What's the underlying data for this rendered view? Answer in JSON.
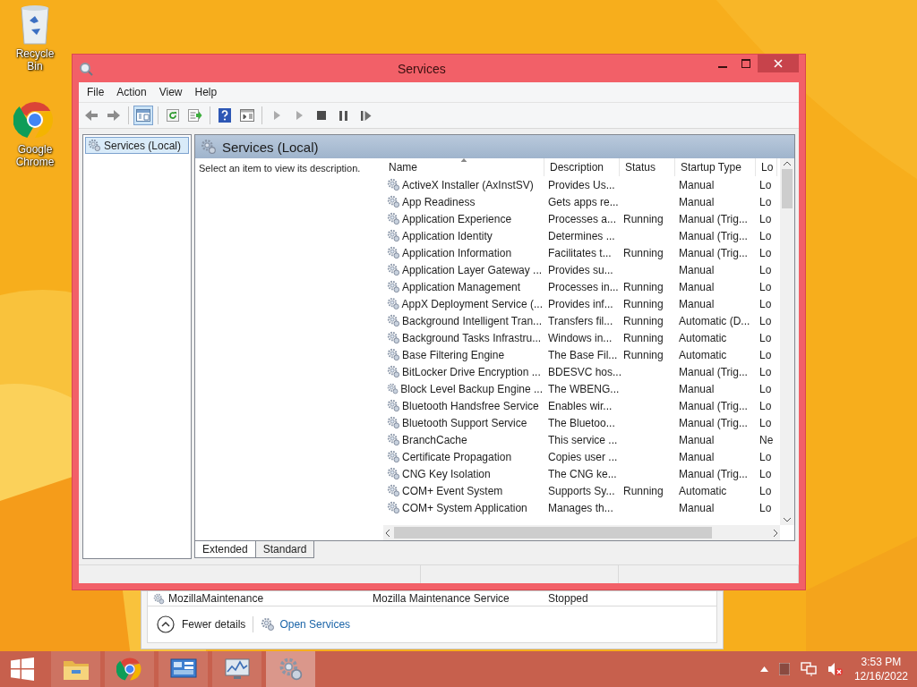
{
  "desktop_icons": [
    {
      "kind": "recycle",
      "label": "Recycle Bin"
    },
    {
      "kind": "chrome",
      "label": "Google Chrome"
    }
  ],
  "window": {
    "title": "Services"
  },
  "menu": [
    "File",
    "Action",
    "View",
    "Help"
  ],
  "toolbar": [
    {
      "kind": "back",
      "pressed": false,
      "disabled": false
    },
    {
      "kind": "forward",
      "pressed": false,
      "disabled": false
    },
    {
      "kind": "tree",
      "pressed": true,
      "disabled": false
    },
    {
      "kind": "refresh",
      "pressed": false,
      "disabled": false
    },
    {
      "kind": "export",
      "pressed": false,
      "disabled": false
    },
    {
      "kind": "help",
      "pressed": false,
      "disabled": false
    },
    {
      "kind": "panel",
      "pressed": false,
      "disabled": false
    },
    {
      "kind": "play",
      "pressed": false,
      "disabled": true
    },
    {
      "kind": "play",
      "pressed": false,
      "disabled": true
    },
    {
      "kind": "stop",
      "pressed": false,
      "disabled": false
    },
    {
      "kind": "pause",
      "pressed": false,
      "disabled": false
    },
    {
      "kind": "resume",
      "pressed": false,
      "disabled": false
    }
  ],
  "tree": [
    {
      "label": "Services (Local)",
      "selected": true
    }
  ],
  "pane": {
    "title": "Services (Local)",
    "description": "Select an item to view its description."
  },
  "table": {
    "columns": [
      {
        "label": "Name",
        "sorted": true
      },
      {
        "label": "Description",
        "sorted": false
      },
      {
        "label": "Status",
        "sorted": false
      },
      {
        "label": "Startup Type",
        "sorted": false
      },
      {
        "label": "Lo",
        "sorted": false
      }
    ],
    "rows": [
      [
        "ActiveX Installer (AxInstSV)",
        "Provides Us...",
        "",
        "Manual",
        "Lo"
      ],
      [
        "App Readiness",
        "Gets apps re...",
        "",
        "Manual",
        "Lo"
      ],
      [
        "Application Experience",
        "Processes a...",
        "Running",
        "Manual (Trig...",
        "Lo"
      ],
      [
        "Application Identity",
        "Determines ...",
        "",
        "Manual (Trig...",
        "Lo"
      ],
      [
        "Application Information",
        "Facilitates t...",
        "Running",
        "Manual (Trig...",
        "Lo"
      ],
      [
        "Application Layer Gateway ...",
        "Provides su...",
        "",
        "Manual",
        "Lo"
      ],
      [
        "Application Management",
        "Processes in...",
        "Running",
        "Manual",
        "Lo"
      ],
      [
        "AppX Deployment Service (...",
        "Provides inf...",
        "Running",
        "Manual",
        "Lo"
      ],
      [
        "Background Intelligent Tran...",
        "Transfers fil...",
        "Running",
        "Automatic (D...",
        "Lo"
      ],
      [
        "Background Tasks Infrastru...",
        "Windows in...",
        "Running",
        "Automatic",
        "Lo"
      ],
      [
        "Base Filtering Engine",
        "The Base Fil...",
        "Running",
        "Automatic",
        "Lo"
      ],
      [
        "BitLocker Drive Encryption ...",
        "BDESVC hos...",
        "",
        "Manual (Trig...",
        "Lo"
      ],
      [
        "Block Level Backup Engine ...",
        "The WBENG...",
        "",
        "Manual",
        "Lo"
      ],
      [
        "Bluetooth Handsfree Service",
        "Enables wir...",
        "",
        "Manual (Trig...",
        "Lo"
      ],
      [
        "Bluetooth Support Service",
        "The Bluetoo...",
        "",
        "Manual (Trig...",
        "Lo"
      ],
      [
        "BranchCache",
        "This service ...",
        "",
        "Manual",
        "Ne"
      ],
      [
        "Certificate Propagation",
        "Copies user ...",
        "",
        "Manual",
        "Lo"
      ],
      [
        "CNG Key Isolation",
        "The CNG ke...",
        "",
        "Manual (Trig...",
        "Lo"
      ],
      [
        "COM+ Event System",
        "Supports Sy...",
        "Running",
        "Automatic",
        "Lo"
      ],
      [
        "COM+ System Application",
        "Manages th...",
        "",
        "Manual",
        "Lo"
      ]
    ]
  },
  "view_tabs": [
    {
      "label": "Extended",
      "selected": true
    },
    {
      "label": "Standard",
      "selected": false
    }
  ],
  "task_manager": {
    "row": [
      "MozillaMaintenance",
      "Mozilla Maintenance Service",
      "Stopped"
    ],
    "fewer_details": "Fewer details",
    "open_services": "Open Services"
  },
  "taskbar": {
    "apps": [
      {
        "kind": "explorer",
        "active": false
      },
      {
        "kind": "chrome",
        "active": false
      },
      {
        "kind": "control",
        "active": false
      },
      {
        "kind": "monitor",
        "active": false
      },
      {
        "kind": "services",
        "active": true
      }
    ],
    "time": "3:53 PM",
    "date": "12/16/2022"
  }
}
